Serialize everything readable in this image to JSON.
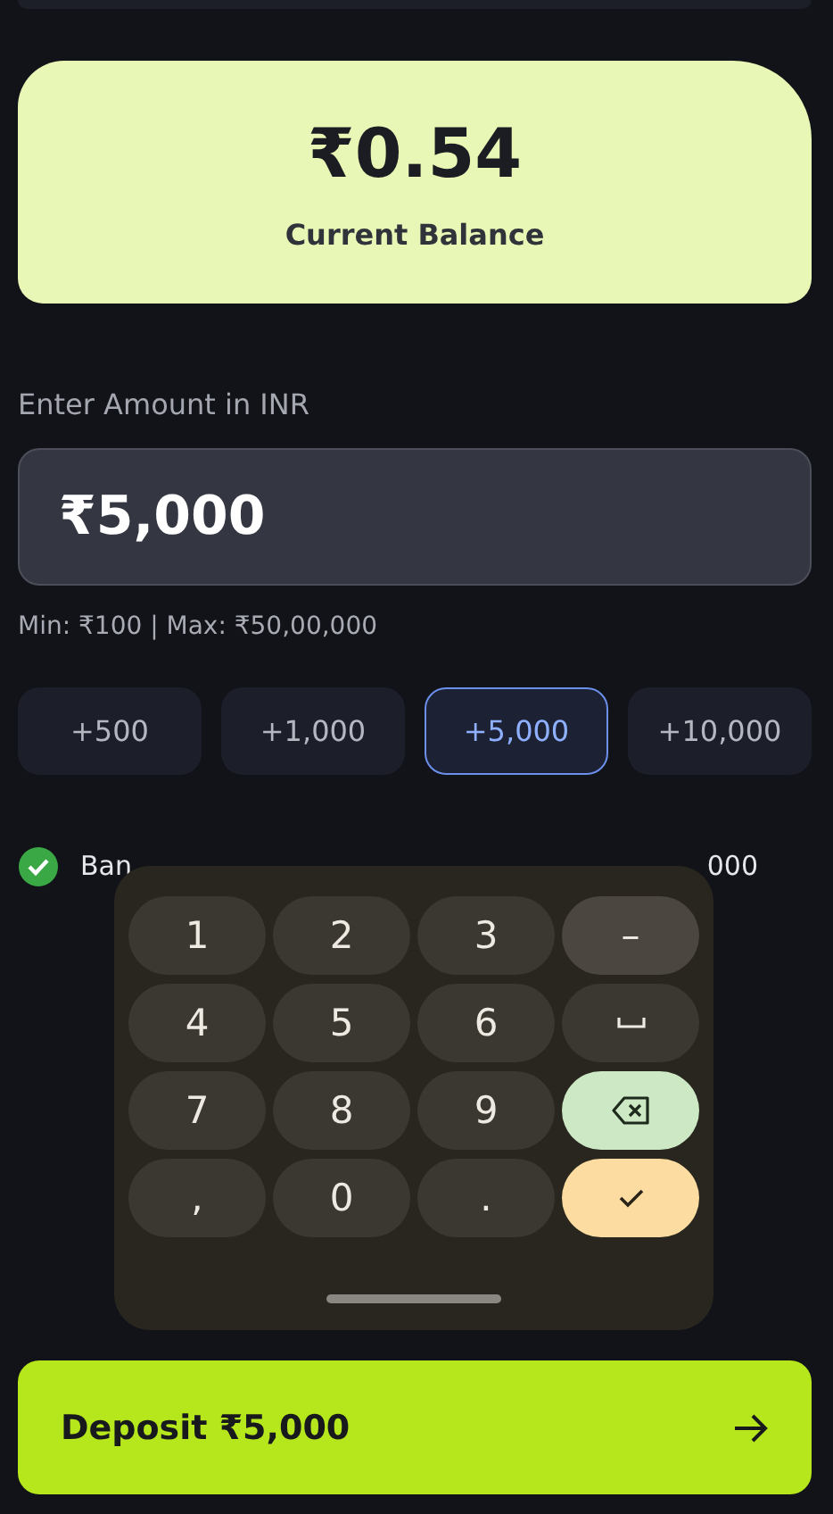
{
  "balance": {
    "amount": "₹0.54",
    "label": "Current Balance"
  },
  "amount_field": {
    "label": "Enter Amount in INR",
    "value": "₹5,000",
    "hint": "Min: ₹100 | Max: ₹50,00,000"
  },
  "quick_amounts": [
    {
      "label": "+500",
      "selected": false
    },
    {
      "label": "+1,000",
      "selected": false
    },
    {
      "label": "+5,000",
      "selected": true
    },
    {
      "label": "+10,000",
      "selected": false
    }
  ],
  "limit_note": {
    "checked": true,
    "text_start": "Ban",
    "text_end": "000"
  },
  "keypad": {
    "keys": [
      {
        "kind": "char",
        "label": "1"
      },
      {
        "kind": "char",
        "label": "2"
      },
      {
        "kind": "char",
        "label": "3"
      },
      {
        "kind": "char",
        "label": "–",
        "accent": true
      },
      {
        "kind": "char",
        "label": "4"
      },
      {
        "kind": "char",
        "label": "5"
      },
      {
        "kind": "char",
        "label": "6"
      },
      {
        "kind": "space"
      },
      {
        "kind": "char",
        "label": "7"
      },
      {
        "kind": "char",
        "label": "8"
      },
      {
        "kind": "char",
        "label": "9"
      },
      {
        "kind": "backspace"
      },
      {
        "kind": "char",
        "label": ","
      },
      {
        "kind": "char",
        "label": "0"
      },
      {
        "kind": "char",
        "label": "."
      },
      {
        "kind": "done"
      }
    ]
  },
  "deposit_button": {
    "label": "Deposit ₹5,000"
  }
}
